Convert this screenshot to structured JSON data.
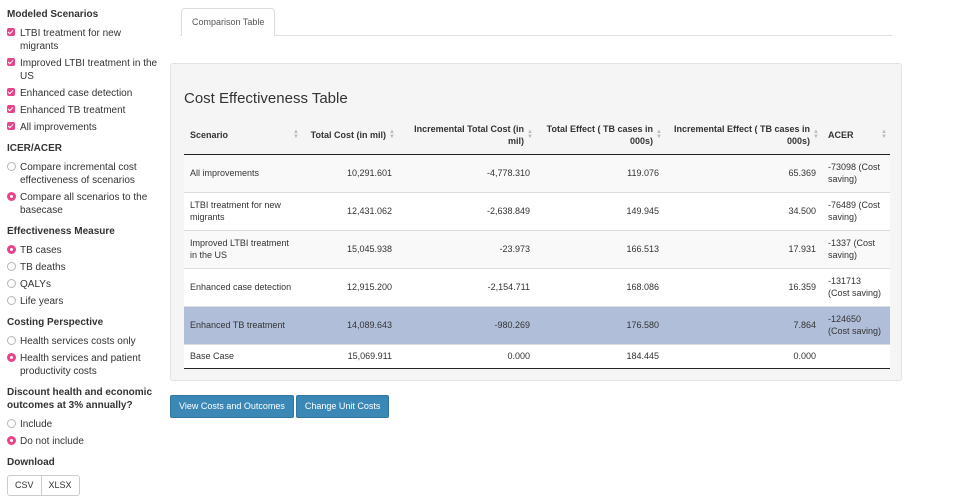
{
  "sidebar": {
    "modeled": {
      "heading": "Modeled Scenarios",
      "items": [
        "LTBI treatment for new migrants",
        "Improved LTBI treatment in the US",
        "Enhanced case detection",
        "Enhanced TB treatment",
        "All improvements"
      ]
    },
    "icer": {
      "heading": "ICER/ACER",
      "options": [
        {
          "label": "Compare incremental cost effectiveness of scenarios",
          "selected": false
        },
        {
          "label": "Compare all scenarios to the basecase",
          "selected": true
        }
      ]
    },
    "effectiveness": {
      "heading": "Effectiveness Measure",
      "options": [
        {
          "label": "TB cases",
          "selected": true
        },
        {
          "label": "TB deaths",
          "selected": false
        },
        {
          "label": "QALYs",
          "selected": false
        },
        {
          "label": "Life years",
          "selected": false
        }
      ]
    },
    "costing": {
      "heading": "Costing Perspective",
      "options": [
        {
          "label": "Health services costs only",
          "selected": false
        },
        {
          "label": "Health services and patient productivity costs",
          "selected": true
        }
      ]
    },
    "discount": {
      "heading": "Discount health and economic outcomes at 3% annually?",
      "options": [
        {
          "label": "Include",
          "selected": false
        },
        {
          "label": "Do not include",
          "selected": true
        }
      ]
    },
    "download": {
      "heading": "Download",
      "csv": "CSV",
      "xlsx": "XLSX"
    }
  },
  "tabs": {
    "active": "Comparison Table"
  },
  "panel": {
    "title": "Cost Effectiveness Table",
    "columns": [
      "Scenario",
      "Total Cost (in mil)",
      "Incremental Total Cost (in mil)",
      "Total Effect ( TB cases in 000s)",
      "Incremental Effect ( TB cases in 000s)",
      "ACER"
    ],
    "rows": [
      [
        "All improvements",
        "10,291.601",
        "-4,778.310",
        "119.076",
        "65.369",
        "-73098 (Cost saving)"
      ],
      [
        "LTBI treatment for new migrants",
        "12,431.062",
        "-2,638.849",
        "149.945",
        "34.500",
        "-76489 (Cost saving)"
      ],
      [
        "Improved LTBI treatment in the US",
        "15,045.938",
        "-23.973",
        "166.513",
        "17.931",
        "-1337 (Cost saving)"
      ],
      [
        "Enhanced case detection",
        "12,915.200",
        "-2,154.711",
        "168.086",
        "16.359",
        "-131713 (Cost saving)"
      ],
      [
        "Enhanced TB treatment",
        "14,089.643",
        "-980.269",
        "176.580",
        "7.864",
        "-124650 (Cost saving)"
      ],
      [
        "Base Case",
        "15,069.911",
        "0.000",
        "184.445",
        "0.000",
        ""
      ]
    ]
  },
  "actions": {
    "view_costs": "View Costs and Outcomes",
    "change_costs": "Change Unit Costs"
  },
  "colors": {
    "accent": "#e8428a",
    "selected_row": "#b0bed9",
    "button": "#3b88b6"
  }
}
